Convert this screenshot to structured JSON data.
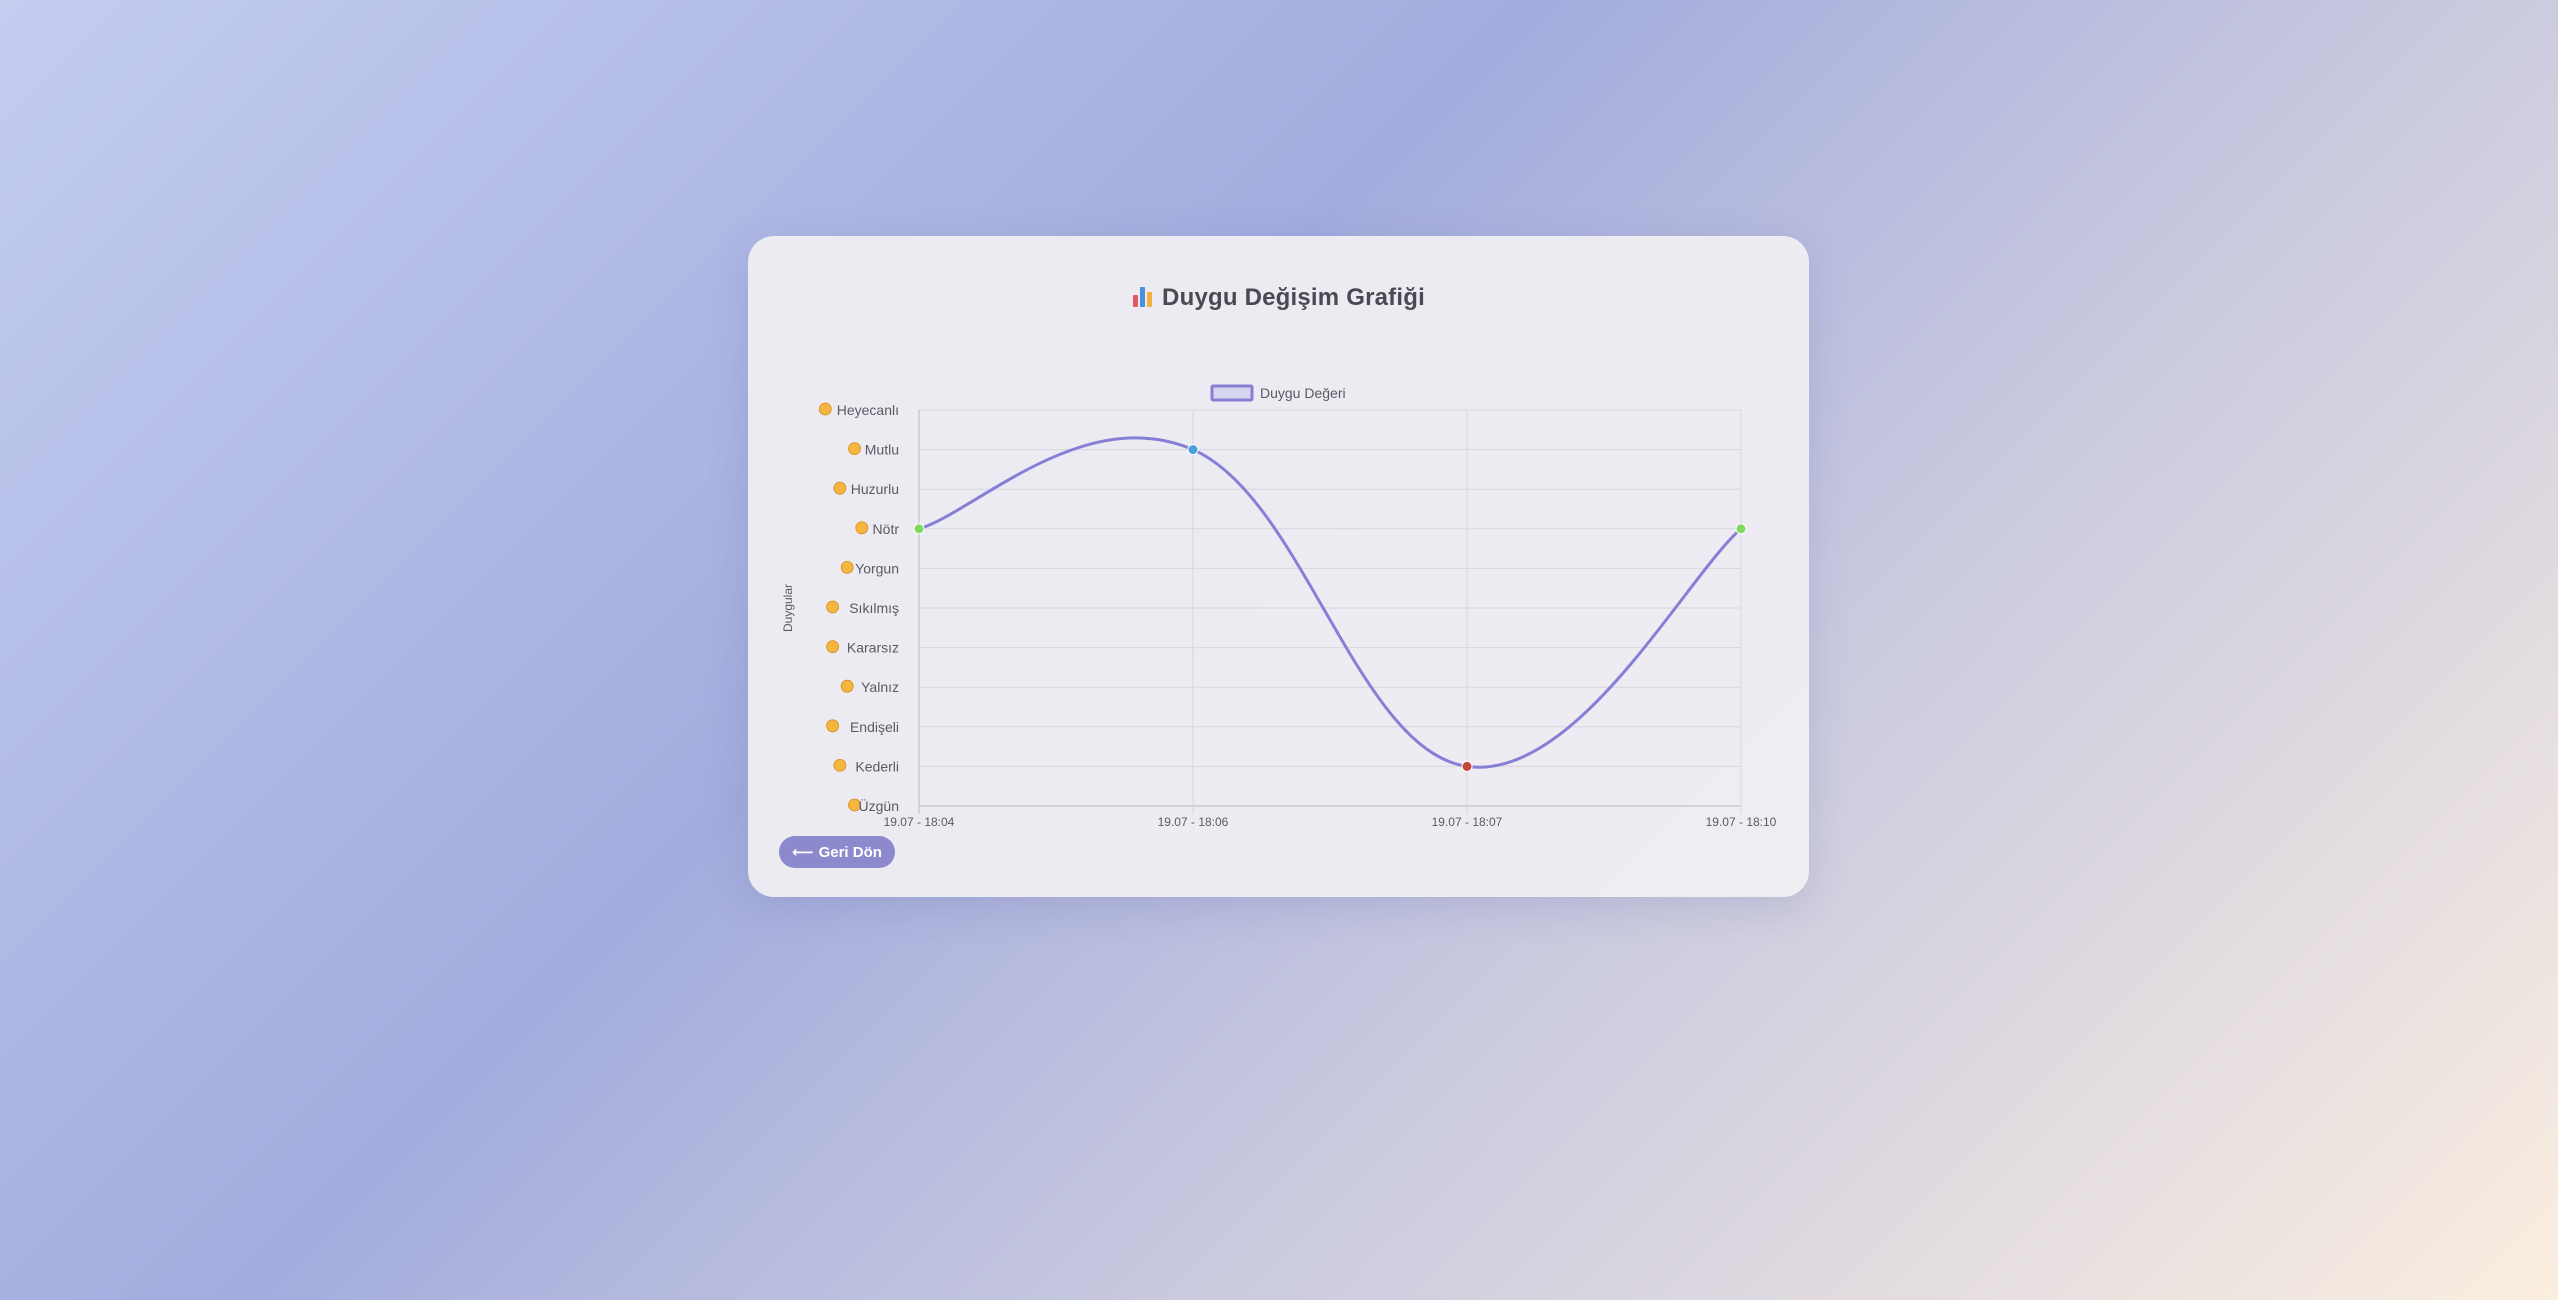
{
  "page": {
    "title": "Duygu Değişim Grafiği",
    "title_icon": "bar-chart-icon",
    "back_button": {
      "icon": "arrow-left-icon",
      "arrow": "⟵",
      "label": "Geri Dön"
    }
  },
  "colors": {
    "line": "#8580d6",
    "point_green": "#7fd960",
    "point_blue": "#4a9fd8",
    "point_red": "#c4473a",
    "grid": "#d8d6dc",
    "button": "#8d89cd"
  },
  "chart_data": {
    "type": "line",
    "title": "",
    "xlabel": "",
    "ylabel": "Duygular",
    "legend": "top-center",
    "grid": true,
    "smooth": true,
    "x": [
      "19.07 - 18:04",
      "19.07 - 18:06",
      "19.07 - 18:07",
      "19.07 - 18:10"
    ],
    "y_categories": [
      "Üzgün",
      "Kederli",
      "Endişeli",
      "Yalnız",
      "Kararsız",
      "Sıkılmış",
      "Yorgun",
      "Nötr",
      "Huzurlu",
      "Mutlu",
      "Heyecanlı"
    ],
    "series": [
      {
        "name": "Duygu Değeri",
        "values": [
          "Nötr",
          "Mutlu",
          "Kederli",
          "Nötr"
        ],
        "point_colors": [
          "#7fd960",
          "#4a9fd8",
          "#c4473a",
          "#7fd960"
        ]
      }
    ]
  }
}
